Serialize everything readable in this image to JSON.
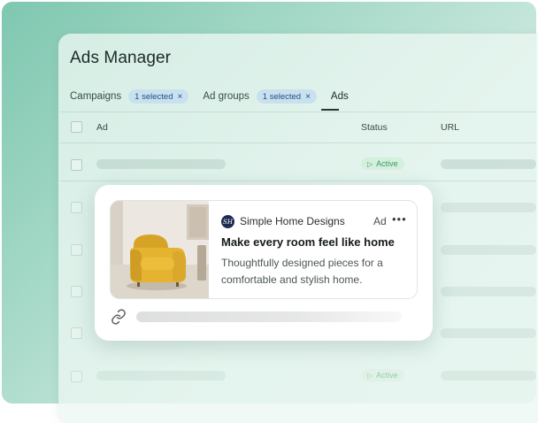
{
  "page": {
    "title": "Ads Manager"
  },
  "filters": [
    {
      "label": "Campaigns",
      "chip": "1 selected"
    },
    {
      "label": "Ad groups",
      "chip": "1 selected"
    }
  ],
  "active_tab": "Ads",
  "table": {
    "headers": {
      "ad": "Ad",
      "status": "Status",
      "url": "URL"
    },
    "rows": [
      {
        "status": "Active"
      },
      {
        "status": "Active"
      }
    ]
  },
  "ad_preview": {
    "brand_initials": "SH",
    "brand": "Simple Home Designs",
    "tag": "Ad",
    "more": "•••",
    "headline": "Make every room feel like home",
    "description": "Thoughtfully designed pieces for a comfortable and stylish home."
  },
  "icons": {
    "chip_close": "×",
    "status": "play-triangle-icon",
    "link": "link-icon"
  },
  "colors": {
    "active_text": "#3e9a5f",
    "active_bg": "#d5efde",
    "chip_bg": "#c9e1ef",
    "chip_text": "#1f4f86"
  }
}
